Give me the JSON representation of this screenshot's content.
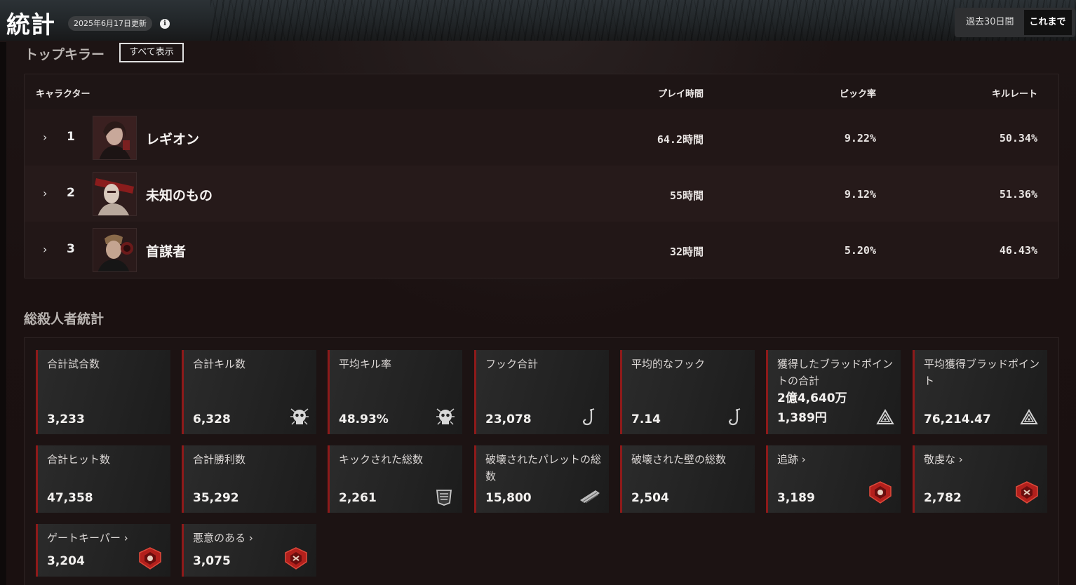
{
  "header": {
    "title": "統計",
    "updated": "2025年6月17日更新",
    "info_glyph": "i",
    "range_options": [
      "過去30日間",
      "これまで"
    ],
    "active_range": "これまで"
  },
  "top_killers": {
    "title": "トップキラー",
    "show_all_label": "すべて表示",
    "columns": [
      "キャラクター",
      "プレイ時間",
      "ピック率",
      "キルレート"
    ],
    "rows": [
      {
        "rank": "1",
        "name": "レギオン",
        "playtime": "64.2時間",
        "pick_rate": "9.22%",
        "kill_rate": "50.34%"
      },
      {
        "rank": "2",
        "name": "未知のもの",
        "playtime": "55時間",
        "pick_rate": "9.12%",
        "kill_rate": "51.36%"
      },
      {
        "rank": "3",
        "name": "首謀者",
        "playtime": "32時間",
        "pick_rate": "5.20%",
        "kill_rate": "46.43%"
      }
    ]
  },
  "killer_stats": {
    "title": "総殺人者統計",
    "cards": [
      {
        "label": "合計試合数",
        "value": "3,233",
        "icon": "none"
      },
      {
        "label": "合計キル数",
        "value": "6,328",
        "icon": "skull-icon"
      },
      {
        "label": "平均キル率",
        "value": "48.93%",
        "icon": "skull-icon"
      },
      {
        "label": "フック合計",
        "value": "23,078",
        "icon": "hook-icon"
      },
      {
        "label": "平均的なフック",
        "value": "7.14",
        "icon": "hook-icon"
      },
      {
        "label": "獲得したブラッドポイントの合計",
        "value": "2億4,640万1,389円",
        "value_line1": "2億4,640万",
        "value_line2": "1,389円",
        "icon": "bloodpoint-icon"
      },
      {
        "label": "平均獲得ブラッドポイント",
        "value": "76,214.47",
        "icon": "bloodpoint-icon"
      },
      {
        "label": "合計ヒット数",
        "value": "47,358",
        "icon": "none"
      },
      {
        "label": "合計勝利数",
        "value": "35,292",
        "icon": "none"
      },
      {
        "label": "キックされた総数",
        "value": "2,261",
        "icon": "generator-icon"
      },
      {
        "label": "破壊されたパレットの総数",
        "value": "15,800",
        "icon": "pallet-icon"
      },
      {
        "label": "破壊された壁の総数",
        "value": "2,504",
        "icon": "none"
      },
      {
        "label": "追跡 ›",
        "value": "3,189",
        "icon": "emblem-icon"
      },
      {
        "label": "敬虔な ›",
        "value": "2,782",
        "icon": "emblem-icon"
      },
      {
        "label": "ゲートキーパー ›",
        "value": "3,204",
        "icon": "emblem-icon"
      },
      {
        "label": "悪意のある ›",
        "value": "3,075",
        "icon": "emblem-icon"
      }
    ]
  },
  "colors": {
    "accent_red": "#8e1a1a",
    "background": "#1a1212",
    "card": "#2b2b2b"
  }
}
